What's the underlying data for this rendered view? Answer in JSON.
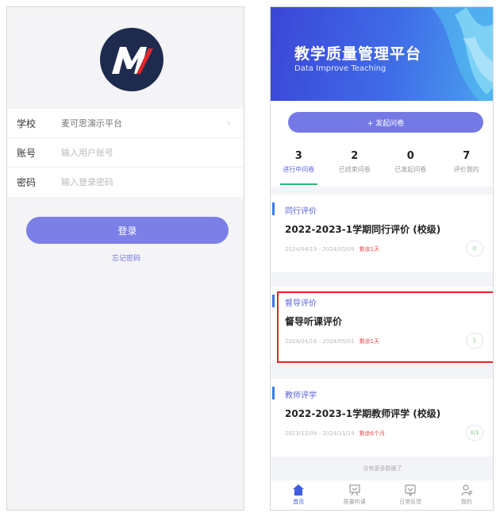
{
  "login": {
    "logo_letter": "M",
    "fields": [
      {
        "label": "学校",
        "value": "麦可思演示平台"
      },
      {
        "label": "账号",
        "placeholder": "输入用户账号"
      },
      {
        "label": "密码",
        "placeholder": "输入登录密码"
      }
    ],
    "login_label": "登录",
    "forgot_label": "忘记密码"
  },
  "home": {
    "banner_title": "教学质量管理平台",
    "banner_subtitle": "Data Improve Teaching",
    "start_label": "+ 发起问卷",
    "stats": [
      {
        "num": "3",
        "label": "进行中问卷"
      },
      {
        "num": "2",
        "label": "已结束问卷"
      },
      {
        "num": "0",
        "label": "已发起问卷"
      },
      {
        "num": "7",
        "label": "评价我的"
      }
    ],
    "cards": [
      {
        "category": "同行评价",
        "title": "2022-2023-1学期同行评价 (校级)",
        "date": "2024/04/19 - 2024/05/09",
        "status": "剩余1天",
        "badge": "0"
      },
      {
        "category": "督导评价",
        "title": "督导听课评价",
        "date": "2024/04/16 - 2024/05/01",
        "status": "剩余1天",
        "badge": "1"
      },
      {
        "category": "教师评学",
        "title": "2022-2023-1学期教师评学 (校级)",
        "date": "2023/12/09 - 2024/11/19",
        "status": "剩余6个月",
        "badge": "0/1"
      }
    ],
    "no_more": "没有更多数据了",
    "tabs": [
      {
        "label": "首页",
        "icon": "home-icon"
      },
      {
        "label": "质量听课",
        "icon": "lecture-icon"
      },
      {
        "label": "日常反馈",
        "icon": "feedback-icon"
      },
      {
        "label": "我的",
        "icon": "user-icon"
      }
    ],
    "colors": {
      "accent": "#7479e6",
      "highlight": "#e02424",
      "status": "#e24b4b"
    }
  }
}
